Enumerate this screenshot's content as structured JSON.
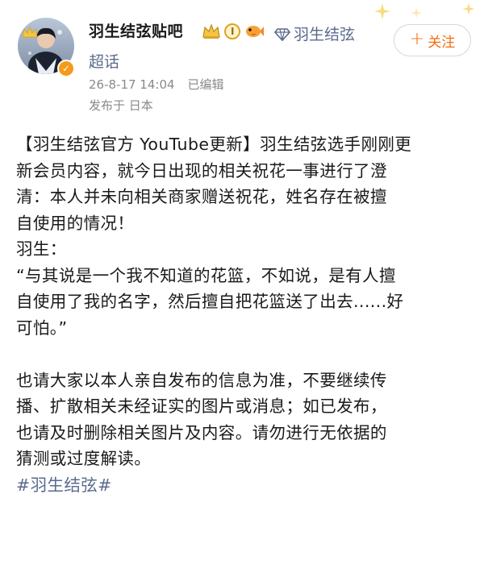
{
  "post": {
    "author_name": "羽生结弦贴吧",
    "level_badge": "Ⅰ",
    "chaohua_label_line1": "羽生结弦",
    "chaohua_label_line2": "超话",
    "follow_button": "关注",
    "follow_plus": "+",
    "timestamp": "26-8-17 14:04",
    "edited": "已编辑",
    "location": "发布于 日本",
    "verified_mark": "✓",
    "body": {
      "paragraph1": [
        "【羽生结弦官方 YouTube更新】羽生结弦选手刚刚更",
        "新会员内容，就今日出现的相关祝花一事进行了澄",
        "清：本人并未向相关商家赠送祝花，姓名存在被擅",
        "自使用的情况！",
        "羽生：",
        "“与其说是一个我不知道的花篮，不如说，是有人擅",
        "自使用了我的名字，然后擅自把花篮送了出去......好",
        "可怕。”"
      ],
      "paragraph2": [
        "也请大家以本人亲自发布的信息为准，不要继续传",
        "播、扩散相关未经证实的图片或消息；如已发布，",
        "也请及时删除相关图片及内容。请勿进行无依据的",
        "猜测或过度解读。"
      ],
      "hashtag": "#羽生结弦#"
    }
  },
  "icons": {
    "avatar": "avatar-image",
    "verified": "verified-badge-icon",
    "crown": "crown-icon",
    "fish": "fish-badge-icon",
    "chaohua": "diamond-chaohua-icon",
    "sparkle": "sparkle-icon"
  },
  "colors": {
    "follow_accent": "#f36d0e",
    "link_blue_gray": "#5a6b8c",
    "meta_gray": "#8a8a8a",
    "verified_orange": "#f59b1a",
    "badge_gold": "#d9a52c"
  }
}
